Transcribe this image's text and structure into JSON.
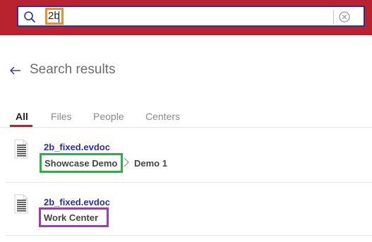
{
  "header": {
    "search": {
      "query": "2b"
    },
    "colors": {
      "bar": "#b8232f",
      "border": "#2b2fa6",
      "query_highlight": "#f28c28"
    }
  },
  "page": {
    "title": "Search results"
  },
  "tabs": [
    {
      "label": "All",
      "active": true
    },
    {
      "label": "Files",
      "active": false
    },
    {
      "label": "People",
      "active": false
    },
    {
      "label": "Centers",
      "active": false
    }
  ],
  "results": [
    {
      "file_name": "2b_fixed.evdoc",
      "path": [
        "Showcase Demo",
        "Demo 1"
      ],
      "highlight_color": "#2fae48"
    },
    {
      "file_name": "2b_fixed.evdoc",
      "path": [
        "Work Center"
      ],
      "highlight_color": "#9a3fb0"
    }
  ],
  "icons": [
    "search-icon",
    "clear-icon",
    "back-arrow-icon",
    "document-icon",
    "chevron-right-icon"
  ]
}
